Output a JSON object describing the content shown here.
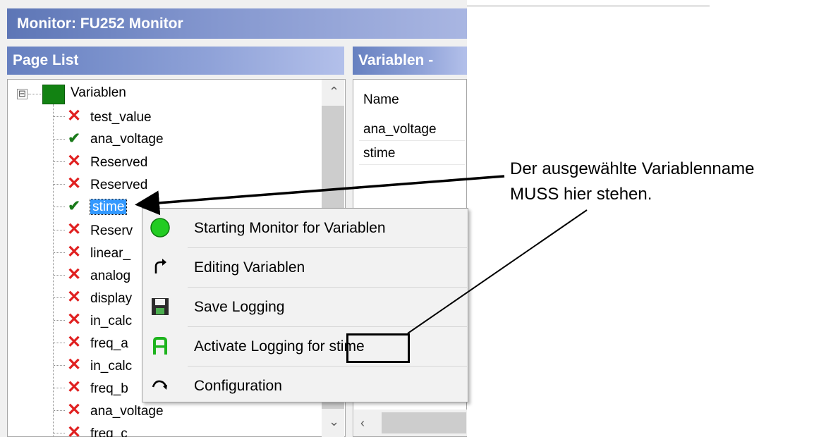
{
  "window": {
    "title": "Monitor: FU252 Monitor"
  },
  "page_list": {
    "header": "Page List",
    "root": {
      "label": "Variablen",
      "expander": "⊟"
    },
    "items": [
      {
        "label": "test_value",
        "status": "x"
      },
      {
        "label": "ana_voltage",
        "status": "check"
      },
      {
        "label": "Reserved",
        "status": "x"
      },
      {
        "label": "Reserved",
        "status": "x"
      },
      {
        "label": "stime",
        "status": "check",
        "selected": true
      },
      {
        "label": "Reserv",
        "status": "x"
      },
      {
        "label": "linear_",
        "status": "x"
      },
      {
        "label": "analog",
        "status": "x"
      },
      {
        "label": "display",
        "status": "x"
      },
      {
        "label": "in_calc",
        "status": "x"
      },
      {
        "label": "freq_a",
        "status": "x"
      },
      {
        "label": "in_calc",
        "status": "x"
      },
      {
        "label": "freq_b",
        "status": "x"
      },
      {
        "label": "ana_voltage",
        "status": "x"
      },
      {
        "label": "freq_c",
        "status": "x"
      }
    ]
  },
  "variables_panel": {
    "header": "Variablen -",
    "column_name": "Name",
    "rows": [
      "ana_voltage",
      "stime"
    ]
  },
  "context_menu": {
    "items": [
      {
        "label": "Starting Monitor for Variablen",
        "icon": "green-circle-icon"
      },
      {
        "label": "Editing Variablen",
        "icon": "curved-arrow-icon"
      },
      {
        "label": "Save Logging",
        "icon": "floppy-disk-icon"
      },
      {
        "label": "Activate Logging for stime",
        "icon": "logging-icon"
      },
      {
        "label": "Configuration",
        "icon": "configuration-icon"
      }
    ]
  },
  "annotation": {
    "line1": "Der ausgewählte Variablenname",
    "line2": "MUSS hier stehen."
  },
  "colors": {
    "title_bar": "#5d76b6",
    "selection": "#3399ff",
    "x_mark": "#e02020",
    "check_mark": "#1a7a1a",
    "root_node": "#128212"
  }
}
